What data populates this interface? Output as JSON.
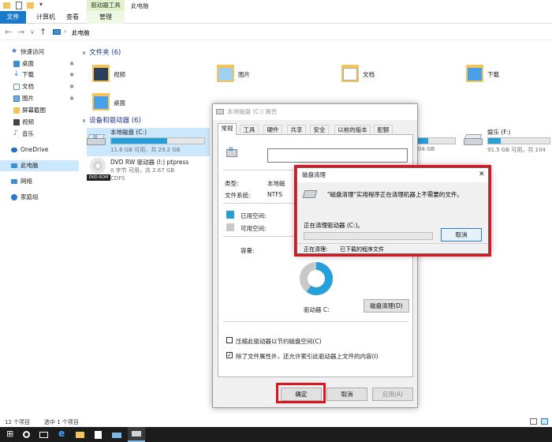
{
  "ribbon": {
    "tabs": [
      "文件",
      "计算机",
      "查看",
      "管理"
    ],
    "context_group": "驱动器工具",
    "window_title": "此电脑"
  },
  "address": {
    "path": "此电脑"
  },
  "nav": {
    "quick_access": "快速访问",
    "items": [
      {
        "label": "桌面",
        "icon": "desktop-icon"
      },
      {
        "label": "下载",
        "icon": "download-icon"
      },
      {
        "label": "文档",
        "icon": "document-icon"
      },
      {
        "label": "图片",
        "icon": "picture-icon"
      },
      {
        "label": "屏幕截图",
        "icon": "folder-icon"
      },
      {
        "label": "视频",
        "icon": "video-icon"
      },
      {
        "label": "音乐",
        "icon": "music-icon"
      }
    ],
    "onedrive": "OneDrive",
    "this_pc": "此电脑",
    "network": "网络",
    "homegroup": "家庭组"
  },
  "folders_section": "文件夹 (6)",
  "folders": [
    {
      "label": "视频"
    },
    {
      "label": "图片"
    },
    {
      "label": "文档"
    },
    {
      "label": "下载"
    },
    {
      "label": "桌面"
    }
  ],
  "drives_section": "设备和驱动器 (6)",
  "drives": {
    "c": {
      "name": "本地磁盘 (C:)",
      "free": "11.6 GB 可用，共 29.2 GB",
      "used_fraction": 0.6
    },
    "dvd": {
      "name": "DVD RW 驱动器 (I:) ptpress",
      "sub1": "0 字节 可用，共 2.67 GB",
      "sub2": "CDFS",
      "badge": "DVD-ROM"
    },
    "d_partial": {
      "sub": "04 GB",
      "used_fraction": 0.3
    },
    "f": {
      "name": "娱乐 (F:)",
      "free": "91.5 GB 可用，共 104",
      "used_fraction": 0.2
    }
  },
  "status": {
    "count": "12 个项目",
    "selected": "选中 1 个项目"
  },
  "props": {
    "title": "本地磁盘 (C:) 属性",
    "tabs": [
      "常规",
      "工具",
      "硬件",
      "共享",
      "安全",
      "以前的版本",
      "配额"
    ],
    "type_label": "类型:",
    "type_value": "本地磁",
    "fs_label": "文件系统:",
    "fs_value": "NTFS",
    "used_label": "已用空间:",
    "free_label": "可用空间:",
    "capacity_label": "容量:",
    "drive_label": "驱动器 C:",
    "cleanup_button": "磁盘清理(D)",
    "compress_label": "压缩此驱动器以节约磁盘空间(C)",
    "index_label": "除了文件属性外，还允许索引此驱动器上文件的内容(I)",
    "ok": "确定",
    "cancel": "取消",
    "apply": "应用(A)",
    "used_fraction": 0.6,
    "colors": {
      "used": "#26a0da",
      "free": "#c8c8c8"
    }
  },
  "cleanup": {
    "title": "磁盘清理",
    "message": "\"磁盘清理\"实用程序正在清理机器上不需要的文件。",
    "cleaning_label": "正在清理驱动器 (C:)。",
    "cancel": "取消",
    "current_label": "正在清理:",
    "current_value": "已下载的程序文件"
  },
  "colors": {
    "accent": "#1979ca",
    "highlight": "#e0141e",
    "selection": "#cce8ff"
  }
}
